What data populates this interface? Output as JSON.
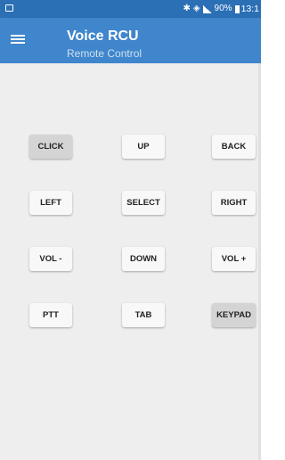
{
  "status_bar": {
    "battery": "90%",
    "time": "13:1",
    "icons": [
      "notification-icon",
      "bluetooth-icon",
      "wifi-icon",
      "signal-icon",
      "battery-icon"
    ]
  },
  "app_bar": {
    "title": "Voice RCU",
    "subtitle": "Remote Control",
    "menu_icon": "hamburger-menu-icon",
    "color": "#3f86cc"
  },
  "buttons": {
    "click": "CLICK",
    "up": "UP",
    "back": "BACK",
    "left": "LEFT",
    "select": "SELECT",
    "right": "RIGHT",
    "vol_down": "VOL -",
    "down": "DOWN",
    "vol_up": "VOL +",
    "ptt": "PTT",
    "tab": "TAB",
    "keypad": "KEYPAD"
  },
  "colors": {
    "status_bar": "#2b6fb5",
    "content_bg": "#eeeeee",
    "button_bg": "#f8f8f8",
    "button_pressed_bg": "#d4d4d4"
  }
}
